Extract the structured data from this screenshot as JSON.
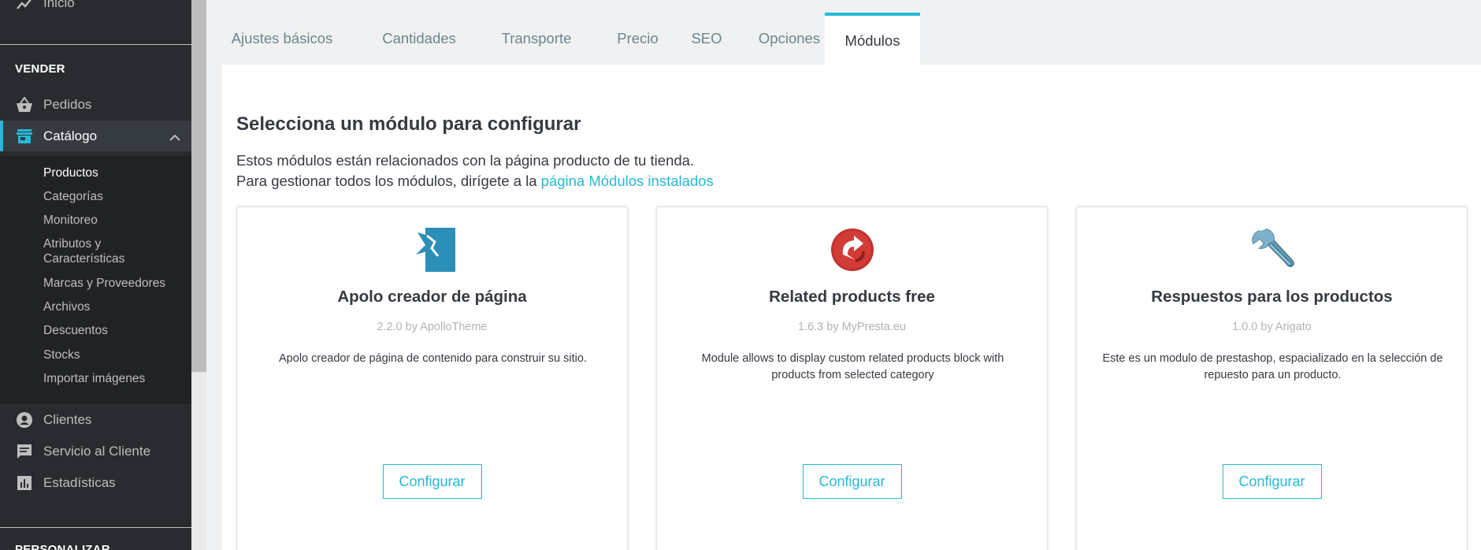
{
  "sidebar": {
    "inicio": "Inicio",
    "section_vender": "VENDER",
    "pedidos": "Pedidos",
    "catalogo": "Catálogo",
    "sub_items": [
      "Productos",
      "Categorías",
      "Monitoreo",
      "Atributos y",
      "Características",
      "Marcas y Proveedores",
      "Archivos",
      "Descuentos",
      "Stocks",
      "Importar imágenes"
    ],
    "clientes": "Clientes",
    "servicio": "Servicio al Cliente",
    "estadisticas": "Estadísticas",
    "section_personalizar": "PERSONALIZAR"
  },
  "tabs": [
    "Ajustes básicos",
    "Cantidades",
    "Transporte",
    "Precio",
    "SEO",
    "Opciones",
    "Módulos"
  ],
  "main": {
    "title": "Selecciona un módulo para configurar",
    "desc_line1": "Estos módulos están relacionados con la página producto de tu tienda.",
    "desc_line2_prefix": "Para gestionar todos los módulos, dirígete a la",
    "desc_link": "página Módulos instalados"
  },
  "modules": [
    {
      "name": "Apolo creador de página",
      "version": "2.2.0 by ApolloTheme",
      "description": "Apolo creador de página de contenido para construir su sitio.",
      "button": "Configurar"
    },
    {
      "name": "Related products free",
      "version": "1.6.3 by MyPresta.eu",
      "description": "Module allows to display custom related products block with products from selected category",
      "button": "Configurar"
    },
    {
      "name": "Respuestos para los productos",
      "version": "1.0.0 by Arigato",
      "description": "Este es un modulo de prestashop, espacializado en la selección de repuesto para un producto.",
      "button": "Configurar"
    }
  ],
  "colors": {
    "accent": "#25b9d7",
    "sidebar_bg": "#282b30",
    "text": "#363a41"
  }
}
